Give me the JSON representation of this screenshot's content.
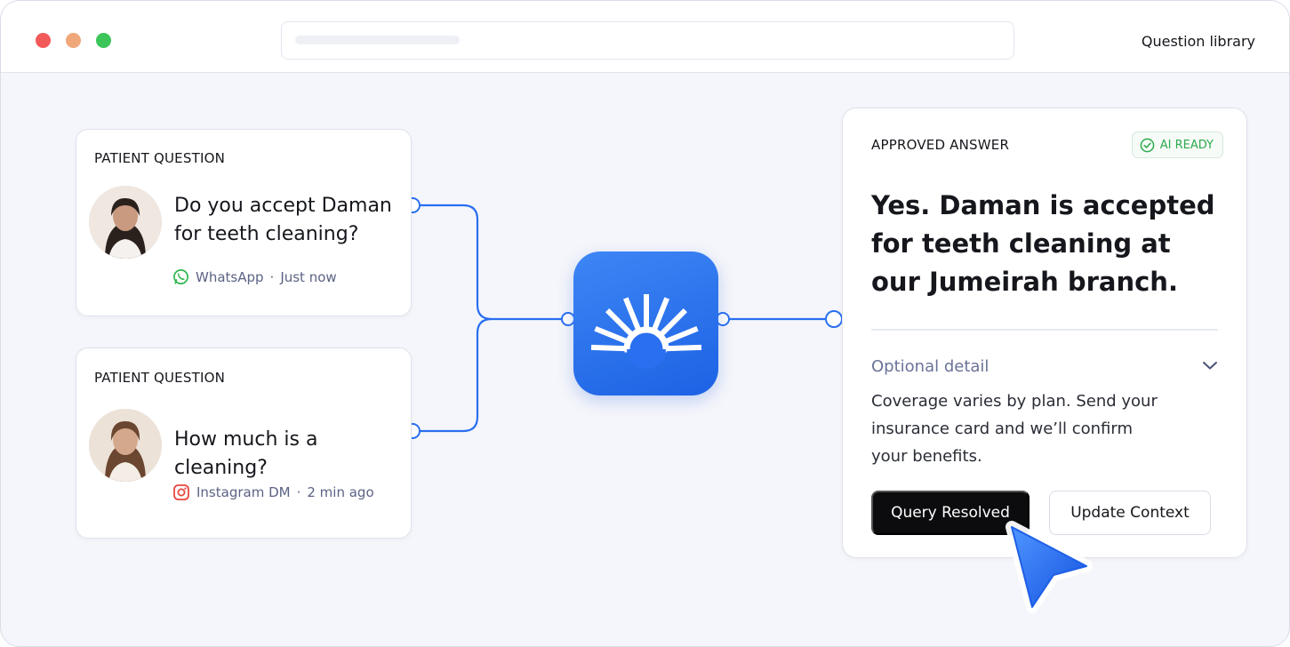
{
  "window": {
    "title_link": "Question library"
  },
  "questions": [
    {
      "label": "PATIENT QUESTION",
      "text_line1": "Do you accept Daman",
      "text_line2": "for teeth cleaning?",
      "channel": "WhatsApp",
      "time": "Just now",
      "channel_icon": "whatsapp-icon"
    },
    {
      "label": "PATIENT QUESTION",
      "text_line1": "How much is a cleaning?",
      "channel": "Instagram DM",
      "time": "2 min ago",
      "channel_icon": "instagram-icon"
    }
  ],
  "answer": {
    "label": "APPROVED ANSWER",
    "badge": "AI READY",
    "text": "Yes. Daman is accepted for teeth cleaning at our Jumeirah branch.",
    "optional_label": "Optional detail",
    "detail": "Coverage varies by plan. Send your insurance card and we’ll confirm your benefits.",
    "primary_button": "Query Resolved",
    "secondary_button": "Update Context"
  },
  "colors": {
    "accent_blue": "#2a6ff0",
    "badge_green": "#2faa4e",
    "primary_button": "#0c0c0e"
  }
}
